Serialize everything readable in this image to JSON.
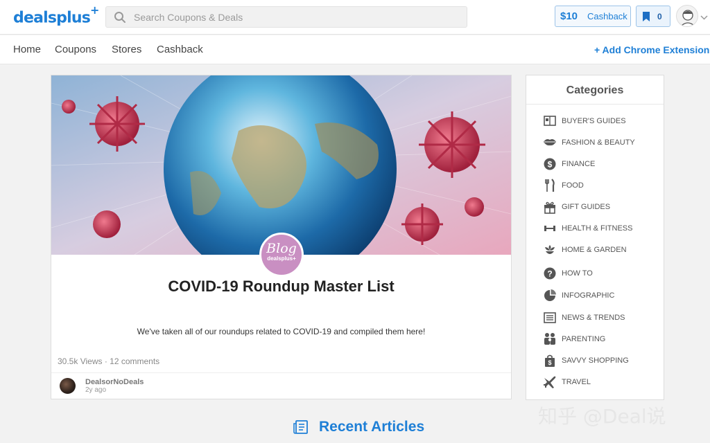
{
  "header": {
    "logo": "dealsplus",
    "logo_plus": "+",
    "search_placeholder": "Search Coupons & Deals",
    "cashback_amount": "$10",
    "cashback_label": "Cashback",
    "saved_count": "0"
  },
  "nav": {
    "items": [
      "Home",
      "Coupons",
      "Stores",
      "Cashback"
    ],
    "extension_link": "+ Add Chrome Extension"
  },
  "article": {
    "badge_line1": "Blog",
    "badge_line2": "dealsplus+",
    "title": "COVID-19 Roundup Master List",
    "description": "We've taken all of our roundups related to COVID-19 and compiled them here!",
    "meta": "30.5k Views · 12 comments",
    "author": "DealsorNoDeals",
    "time": "2y ago"
  },
  "categories": {
    "title": "Categories",
    "items": [
      {
        "label": "BUYER'S GUIDES",
        "icon": "guide-book-icon"
      },
      {
        "label": "FASHION & BEAUTY",
        "icon": "lips-icon"
      },
      {
        "label": "FINANCE",
        "icon": "dollar-coin-icon"
      },
      {
        "label": "FOOD",
        "icon": "fork-knife-icon"
      },
      {
        "label": "GIFT GUIDES",
        "icon": "gift-icon"
      },
      {
        "label": "HEALTH & FITNESS",
        "icon": "dumbbell-icon"
      },
      {
        "label": "HOME & GARDEN",
        "icon": "flower-icon"
      },
      {
        "label": "HOW TO",
        "icon": "question-icon"
      },
      {
        "label": "INFOGRAPHIC",
        "icon": "pie-chart-icon"
      },
      {
        "label": "NEWS & TRENDS",
        "icon": "newspaper-icon"
      },
      {
        "label": "PARENTING",
        "icon": "family-icon"
      },
      {
        "label": "SAVVY SHOPPING",
        "icon": "shopping-bag-icon"
      },
      {
        "label": "TRAVEL",
        "icon": "airplane-icon"
      }
    ]
  },
  "recent": {
    "title": "Recent Articles"
  },
  "watermark": "知乎 @Deal说",
  "colors": {
    "brand_blue": "#1e7fd6",
    "badge_pink": "#c98fc2"
  }
}
